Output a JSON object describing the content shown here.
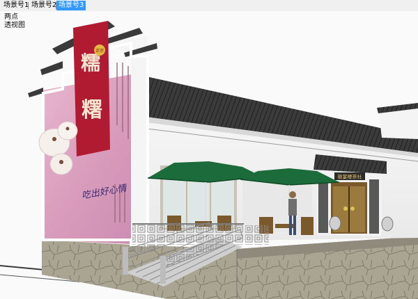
{
  "tabs": [
    {
      "label": "场景号1",
      "active": false
    },
    {
      "label": "场景号2",
      "active": false
    },
    {
      "label": "场景号3",
      "active": true
    }
  ],
  "viewport": {
    "camera_mode": "两点",
    "projection": "透视图"
  },
  "sign_text": "徽宴楼茶社",
  "mural": {
    "title_char_1": "糯",
    "title_char_2": "糬",
    "badge": "正宗",
    "slogan": "吃出好心情"
  },
  "colors": {
    "active_tab": "#3399ff",
    "umbrella": "#1c6b3a",
    "roof": "#3a3a3a",
    "stone": "#a9a391"
  }
}
